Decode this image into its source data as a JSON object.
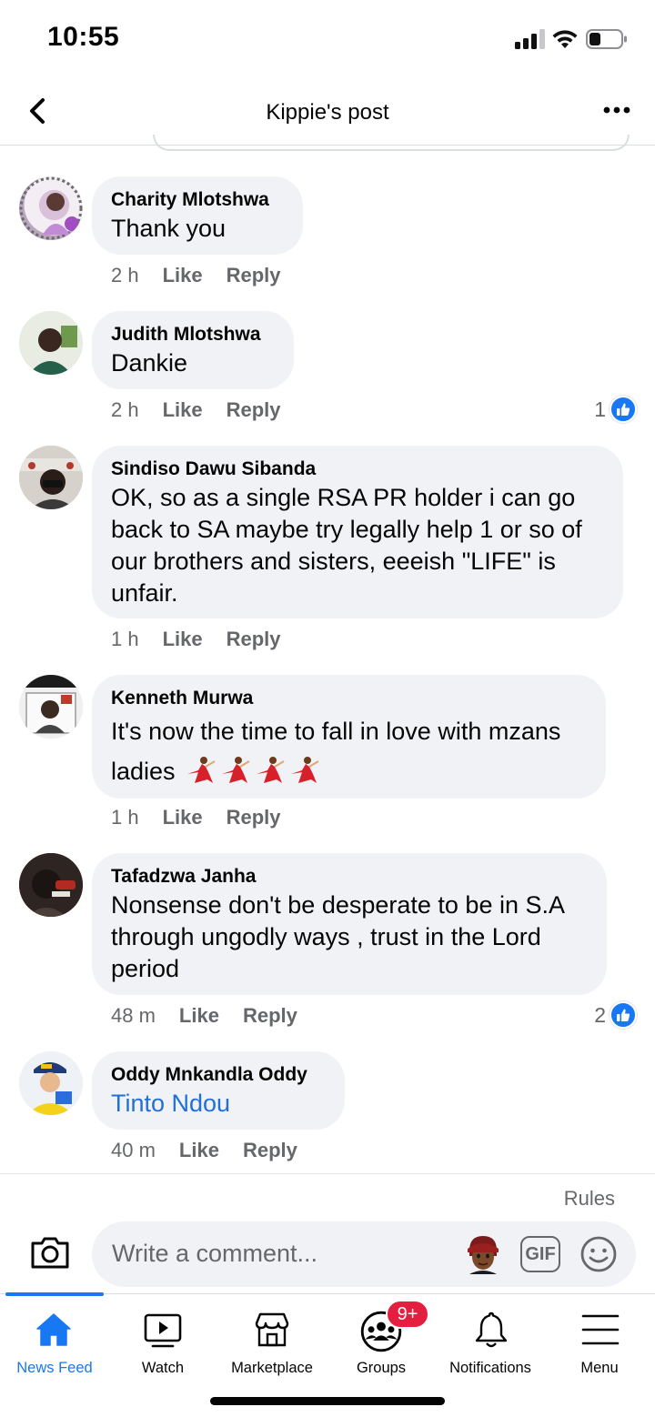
{
  "status_bar": {
    "time": "10:55"
  },
  "header": {
    "title": "Kippie's post"
  },
  "comments": [
    {
      "author": "Charity Mlotshwa",
      "text": "Thank you",
      "time": "2 h",
      "like_label": "Like",
      "reply_label": "Reply"
    },
    {
      "author": "Judith Mlotshwa",
      "text": "Dankie",
      "time": "2 h",
      "like_label": "Like",
      "reply_label": "Reply",
      "reactions": "1"
    },
    {
      "author": "Sindiso Dawu Sibanda",
      "text": "OK, so as a single RSA PR holder i can go back to SA maybe try legally help 1 or so of our brothers and sisters, eeeish \"LIFE\" is unfair.",
      "time": "1 h",
      "like_label": "Like",
      "reply_label": "Reply"
    },
    {
      "author": "Kenneth Murwa",
      "text": "It's now the time to fall in love with mzans ladies",
      "time": "1 h",
      "like_label": "Like",
      "reply_label": "Reply"
    },
    {
      "author": "Tafadzwa Janha",
      "text": "Nonsense don't be desperate to be in S.A through ungodly ways , trust in the Lord period",
      "time": "48 m",
      "like_label": "Like",
      "reply_label": "Reply",
      "reactions": "2"
    },
    {
      "author": "Oddy Mnkandla Oddy",
      "text": "Tinto Ndou",
      "time": "40 m",
      "like_label": "Like",
      "reply_label": "Reply"
    }
  ],
  "composer": {
    "rules_label": "Rules",
    "placeholder": "Write a comment...",
    "gif_label": "GIF"
  },
  "tabbar": {
    "tabs": [
      {
        "label": "News Feed",
        "icon": "home-icon",
        "active": true
      },
      {
        "label": "Watch",
        "icon": "watch-icon"
      },
      {
        "label": "Marketplace",
        "icon": "marketplace-icon"
      },
      {
        "label": "Groups",
        "icon": "groups-icon",
        "badge": "9+"
      },
      {
        "label": "Notifications",
        "icon": "bell-icon"
      },
      {
        "label": "Menu",
        "icon": "menu-icon"
      }
    ]
  },
  "colors": {
    "accent": "#1877f2",
    "badge": "#e41e3f",
    "bubble": "#f0f2f5",
    "muted": "#65676b",
    "link": "#216fdb"
  }
}
